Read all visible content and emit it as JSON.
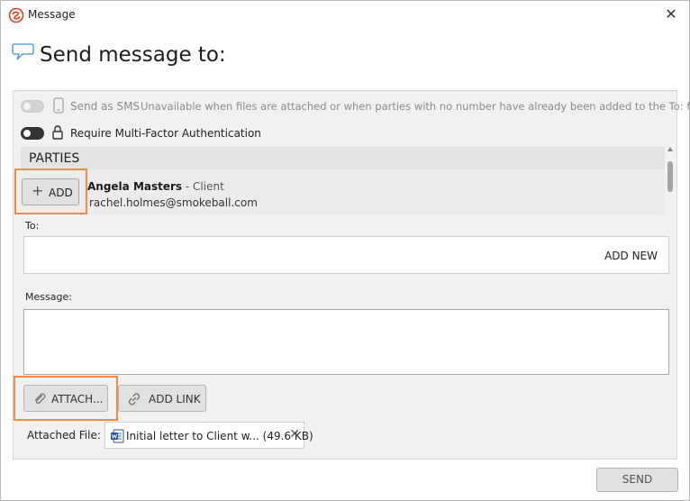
{
  "window": {
    "title": "Message",
    "close_glyph": "✕"
  },
  "header": {
    "title": "Send message to:",
    "icon": "speech-bubble-icon"
  },
  "options": {
    "sms_label": "Send as SMS",
    "sms_note": "Unavailable when files are attached or when parties with no number have already been added to the To: field.",
    "mfa_label": "Require Multi-Factor Authentication"
  },
  "parties": {
    "heading": "PARTIES",
    "add_label": "ADD",
    "items": [
      {
        "name": "Angela Masters",
        "role": " - Client",
        "email": "rachel.holmes@smokeball.com"
      }
    ]
  },
  "to": {
    "label": "To:",
    "add_new_label": "ADD NEW"
  },
  "message": {
    "label": "Message:"
  },
  "actions": {
    "attach_label": "ATTACH...",
    "add_link_label": "ADD LINK"
  },
  "attached": {
    "label": "Attached File:",
    "file_name": "Initial letter to Client w... (49.6 KB)",
    "remove_glyph": "✕"
  },
  "footer": {
    "send_label": "SEND"
  },
  "colors": {
    "accent_orange": "#ee8a4a",
    "brand_red": "#e0401f",
    "word_blue": "#2b579a"
  }
}
